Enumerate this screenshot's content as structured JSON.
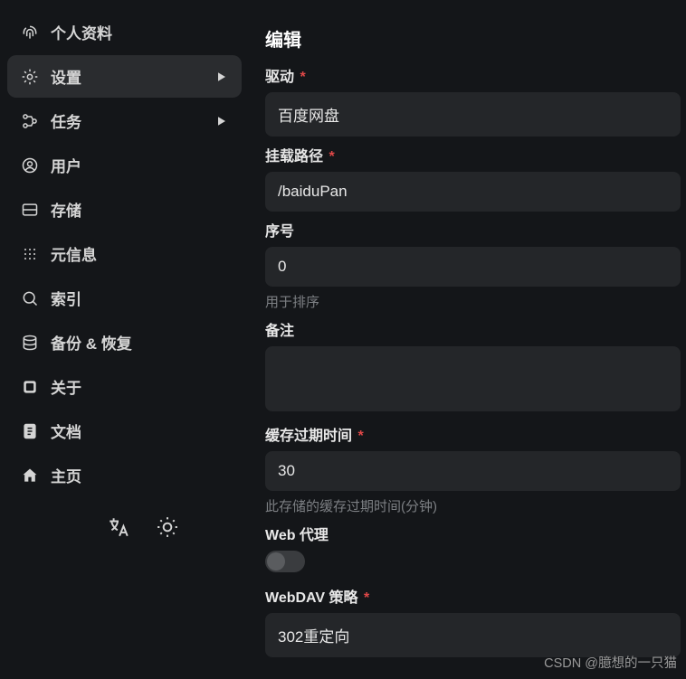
{
  "sidebar": {
    "items": [
      {
        "label": "个人资料",
        "icon": "fingerprint"
      },
      {
        "label": "设置",
        "icon": "gear",
        "active": true,
        "expandable": true
      },
      {
        "label": "任务",
        "icon": "tasks",
        "expandable": true
      },
      {
        "label": "用户",
        "icon": "user"
      },
      {
        "label": "存储",
        "icon": "storage"
      },
      {
        "label": "元信息",
        "icon": "meta"
      },
      {
        "label": "索引",
        "icon": "search"
      },
      {
        "label": "备份 & 恢复",
        "icon": "database"
      },
      {
        "label": "关于",
        "icon": "about"
      },
      {
        "label": "文档",
        "icon": "docs"
      },
      {
        "label": "主页",
        "icon": "home"
      }
    ]
  },
  "main": {
    "title": "编辑",
    "fields": {
      "driver": {
        "label": "驱动",
        "value": "百度网盘",
        "required": true
      },
      "mount_path": {
        "label": "挂载路径",
        "value": "/baiduPan",
        "required": true
      },
      "order": {
        "label": "序号",
        "value": "0",
        "helper": "用于排序"
      },
      "remark": {
        "label": "备注",
        "value": ""
      },
      "cache_expire": {
        "label": "缓存过期时间",
        "value": "30",
        "required": true,
        "helper": "此存储的缓存过期时间(分钟)"
      },
      "web_proxy": {
        "label": "Web 代理",
        "value": false
      },
      "webdav_policy": {
        "label": "WebDAV 策略",
        "value": "302重定向",
        "required": true
      }
    }
  },
  "watermark": "CSDN @臆想的一只猫"
}
